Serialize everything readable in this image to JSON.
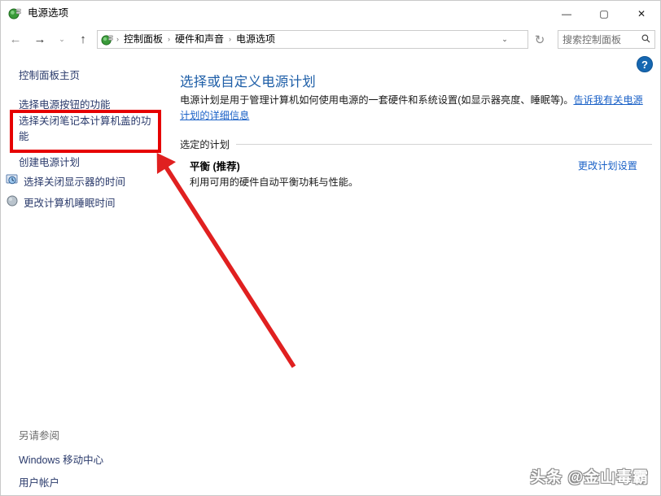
{
  "window": {
    "title": "电源选项",
    "icon": "power-plug-icon",
    "minimize": "—",
    "maximize": "▢",
    "close": "✕"
  },
  "navbar": {
    "back": "←",
    "forward": "→",
    "history": "⌄",
    "up": "↑",
    "address_icon": "power-plug-icon",
    "breadcrumbs": [
      "控制面板",
      "硬件和声音",
      "电源选项"
    ],
    "separator": "›",
    "dropdown": "⌄",
    "refresh": "↻",
    "search_placeholder": "搜索控制面板",
    "search_icon": "🔍"
  },
  "sidebar": {
    "home": "控制面板主页",
    "links": [
      {
        "label": "选择电源按钮的功能",
        "icon": null
      },
      {
        "label": "选择关闭笔记本计算机盖的功能",
        "icon": null
      },
      {
        "label": "创建电源计划",
        "icon": null
      },
      {
        "label": "选择关闭显示器的时间",
        "icon": "monitor-clock-icon"
      },
      {
        "label": "更改计算机睡眠时间",
        "icon": "sleep-moon-icon"
      }
    ],
    "see_also_heading": "另请参阅",
    "see_also": [
      "Windows 移动中心",
      "用户帐户"
    ]
  },
  "main": {
    "title": "选择或自定义电源计划",
    "description_pre": "电源计划是用于管理计算机如何使用电源的一套硬件和系统设置(如显示器亮度、睡眠等)。",
    "description_link": "告诉我有关电源计划的详细信息",
    "section_label": "选定的计划",
    "plan_name": "平衡 (推荐)",
    "plan_desc": "利用可用的硬件自动平衡功耗与性能。",
    "plan_link": "更改计划设置",
    "help_icon": "?"
  },
  "annotations": {
    "highlight_color": "#e60000",
    "arrow_color": "#e02020",
    "highlight_target": "选择关闭笔记本计算机盖的功能"
  },
  "watermark": "头条 @金山毒霸"
}
